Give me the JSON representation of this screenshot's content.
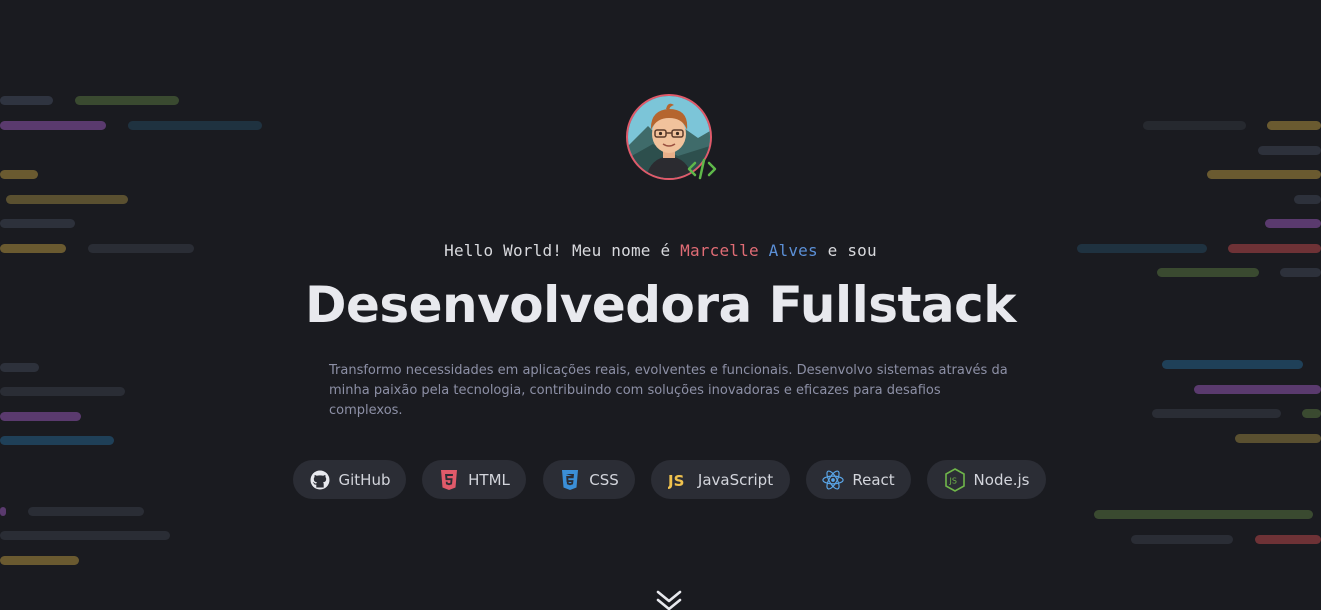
{
  "hero": {
    "greeting_prefix": "Hello World! Meu nome é",
    "first_name": "Marcelle",
    "last_name": "Alves",
    "greeting_suffix": "e sou",
    "title": "Desenvolvedora Fullstack",
    "description": "Transformo necessidades em aplicações reais, evolventes e funcionais. Desenvolvo sistemas através da minha paixão pela tecnologia, contribuindo com soluções inovadoras e eficazes para desafios complexos."
  },
  "techs": [
    {
      "label": "GitHub",
      "icon": "github-icon"
    },
    {
      "label": "HTML",
      "icon": "html5-icon"
    },
    {
      "label": "CSS",
      "icon": "css3-icon"
    },
    {
      "label": "JavaScript",
      "icon": "js-icon"
    },
    {
      "label": "React",
      "icon": "react-icon"
    },
    {
      "label": "Node.js",
      "icon": "nodejs-icon"
    }
  ],
  "colors": {
    "background": "#1a1b20",
    "accent_red": "#e06c75",
    "accent_blue": "#5b8fd6",
    "chip_bg": "#2b2d35"
  }
}
